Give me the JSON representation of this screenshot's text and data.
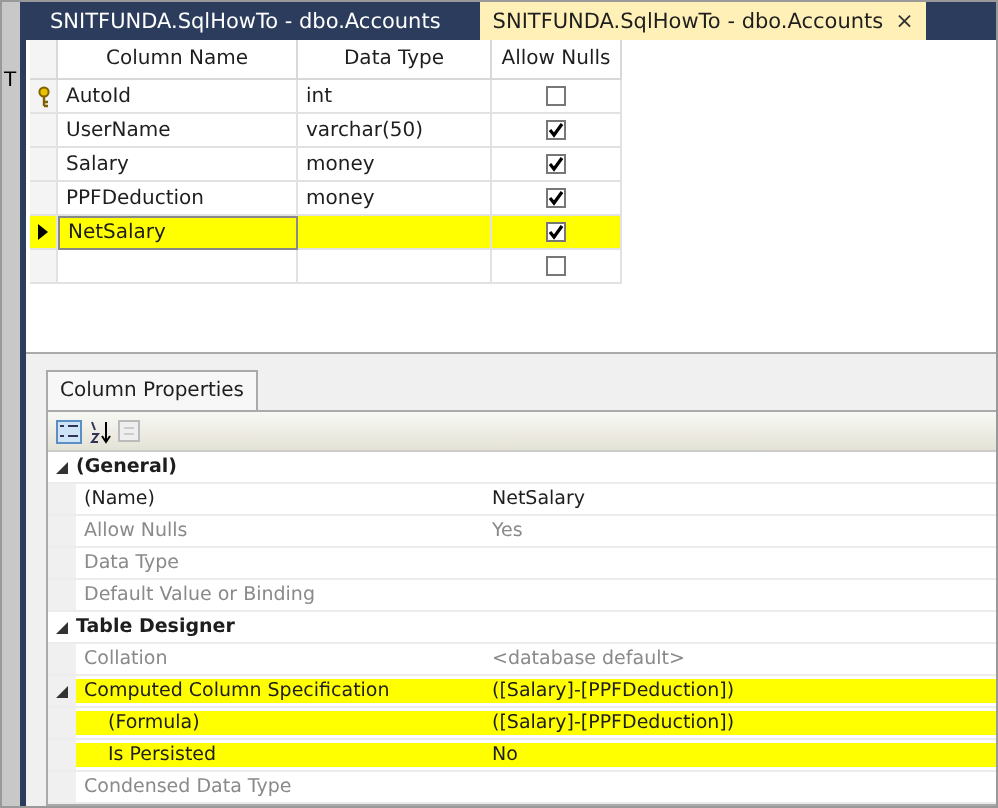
{
  "tabs": [
    {
      "label": "SNITFUNDA.SqlHowTo - dbo.Accounts",
      "selected": false,
      "closable": false
    },
    {
      "label": "SNITFUNDA.SqlHowTo - dbo.Accounts",
      "selected": true,
      "closable": true,
      "close_glyph": "×"
    }
  ],
  "edge_text": "T",
  "grid": {
    "columns": [
      "Column Name",
      "Data Type",
      "Allow Nulls"
    ],
    "rows": [
      {
        "name": "AutoId",
        "type": "int",
        "primary_key": true,
        "allow_nulls": false,
        "selected": false,
        "highlighted": false
      },
      {
        "name": "UserName",
        "type": "varchar(50)",
        "primary_key": false,
        "allow_nulls": true,
        "selected": false,
        "highlighted": false
      },
      {
        "name": "Salary",
        "type": "money",
        "primary_key": false,
        "allow_nulls": true,
        "selected": false,
        "highlighted": false
      },
      {
        "name": "PPFDeduction",
        "type": "money",
        "primary_key": false,
        "allow_nulls": true,
        "selected": false,
        "highlighted": false
      },
      {
        "name": "NetSalary",
        "primary_key": false,
        "allow_nulls": true,
        "selected": true,
        "highlighted": true
      },
      {
        "primary_key": false,
        "allow_nulls": false,
        "selected": false,
        "highlighted": false
      }
    ]
  },
  "properties_panel": {
    "tab": "Column Properties",
    "items": [
      {
        "kind": "category",
        "label": "(General)",
        "expanded": true,
        "children": [
          {
            "kind": "property",
            "label": "(Name)",
            "value": "NetSalary",
            "disabled": false,
            "highlighted": false
          },
          {
            "kind": "property",
            "label": "Allow Nulls",
            "value": "Yes",
            "disabled": true,
            "highlighted": false
          },
          {
            "kind": "property",
            "label": "Data Type",
            "disabled": true,
            "highlighted": false
          },
          {
            "kind": "property",
            "label": "Default Value or Binding",
            "disabled": true,
            "highlighted": false
          }
        ]
      },
      {
        "kind": "category",
        "label": "Table Designer",
        "expanded": true,
        "children": [
          {
            "kind": "property",
            "label": "Collation",
            "value": "<database default>",
            "disabled": true,
            "highlighted": false
          },
          {
            "kind": "property",
            "label": "Computed Column Specification",
            "value": "([Salary]-[PPFDeduction])",
            "disabled": false,
            "highlighted": true,
            "expanded": true,
            "children": [
              {
                "kind": "property",
                "label": "(Formula)",
                "value": "([Salary]-[PPFDeduction])",
                "disabled": false,
                "highlighted": true
              },
              {
                "kind": "property",
                "label": "Is Persisted",
                "value": "No",
                "disabled": false,
                "highlighted": true
              }
            ]
          },
          {
            "kind": "property",
            "label": "Condensed Data Type",
            "disabled": true,
            "highlighted": false
          }
        ]
      }
    ]
  }
}
